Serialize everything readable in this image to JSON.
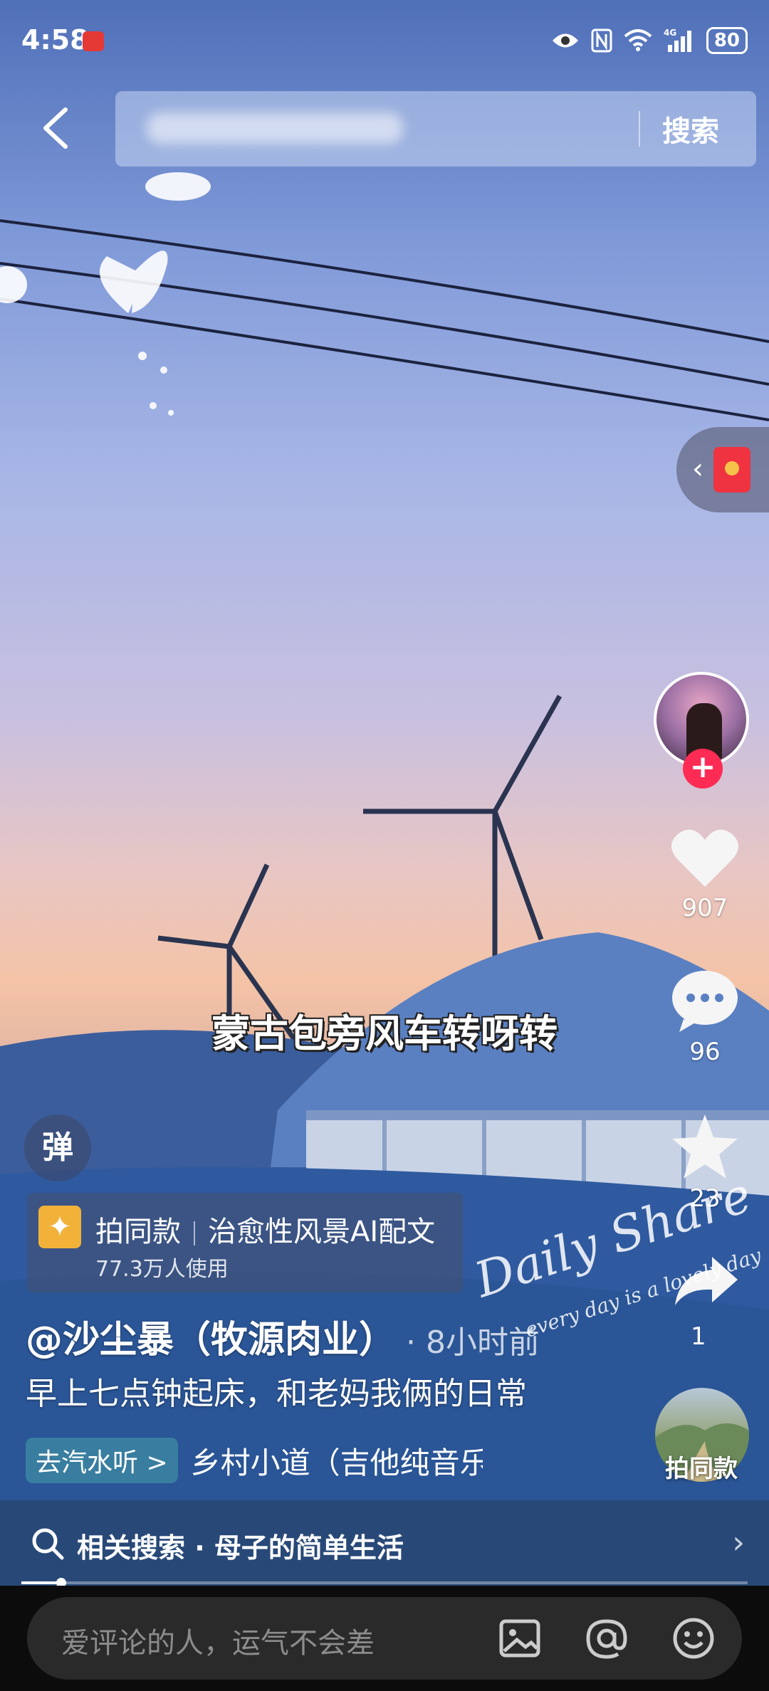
{
  "status_bar": {
    "time": "4:58",
    "network": "4G",
    "battery": "80",
    "icons": [
      "eye-icon",
      "nfc-icon",
      "wifi-icon",
      "signal-icon",
      "battery-icon"
    ]
  },
  "header": {
    "search_button": "搜索"
  },
  "right_rail": {
    "likes": "907",
    "comments": "96",
    "favorites": "23",
    "shares": "1",
    "same_style_label": "拍同款"
  },
  "danmaku_label": "弹",
  "subtitle": "蒙古包旁风车转呀转",
  "template": {
    "label": "拍同款",
    "name": "治愈性风景AI配文",
    "usage": "77.3万人使用"
  },
  "post": {
    "author": "@沙尘暴（牧源肉业）",
    "time_ago": "· 8小时前",
    "description": "早上七点钟起床，和老妈我俩的日常",
    "car_listen": "去汽水听 >",
    "music": "乡村小道（吉他纯音乐）"
  },
  "watermark": {
    "main": "Daily Share",
    "sub": "every day is a lovely day"
  },
  "related_search": "相关搜索 · 母子的简单生活",
  "video_progress": 0.055,
  "comment_placeholder": "爱评论的人，运气不会差",
  "colors": {
    "accent_red": "#fe2c55",
    "template_icon": "#f2b23a"
  }
}
